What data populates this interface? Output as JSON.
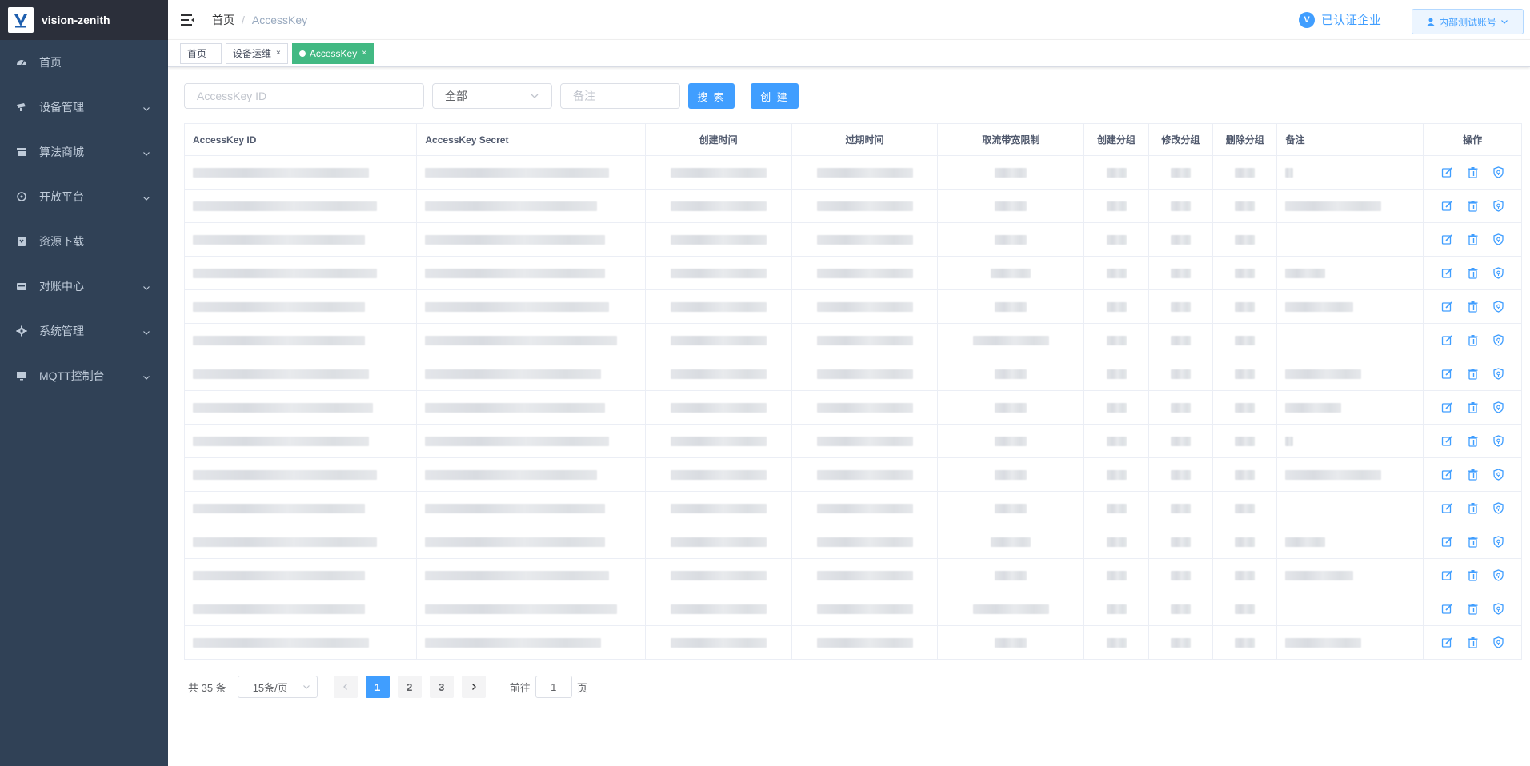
{
  "app": {
    "title": "vision-zenith"
  },
  "sidebar": {
    "items": [
      {
        "label": "首页",
        "icon": "dashboard-icon",
        "has_arrow": false
      },
      {
        "label": "设备管理",
        "icon": "device-icon",
        "has_arrow": true
      },
      {
        "label": "算法商城",
        "icon": "shop-icon",
        "has_arrow": true
      },
      {
        "label": "开放平台",
        "icon": "platform-icon",
        "has_arrow": true
      },
      {
        "label": "资源下载",
        "icon": "download-icon",
        "has_arrow": false
      },
      {
        "label": "对账中心",
        "icon": "billing-icon",
        "has_arrow": true
      },
      {
        "label": "系统管理",
        "icon": "settings-icon",
        "has_arrow": true
      },
      {
        "label": "MQTT控制台",
        "icon": "monitor-icon",
        "has_arrow": true
      }
    ]
  },
  "navbar": {
    "breadcrumb_home": "首页",
    "breadcrumb_sep": "/",
    "breadcrumb_current": "AccessKey",
    "verified_badge": "V",
    "verified_label": "已认证企业",
    "account_label": "内部测试账号"
  },
  "tags": [
    {
      "label": "首页",
      "closable": false,
      "active": false
    },
    {
      "label": "设备运维",
      "closable": true,
      "active": false
    },
    {
      "label": "AccessKey",
      "closable": true,
      "active": true
    }
  ],
  "filters": {
    "id_placeholder": "AccessKey ID",
    "select_value": "全部",
    "remark_placeholder": "备注",
    "search_label": "搜 索",
    "create_label": "创 建"
  },
  "table": {
    "headers": [
      "AccessKey ID",
      "AccessKey Secret",
      "创建时间",
      "过期时间",
      "取流带宽限制",
      "创建分组",
      "修改分组",
      "删除分组",
      "备注",
      "操作"
    ],
    "row_count": 15
  },
  "pagination": {
    "total_label": "共 35 条",
    "page_size_label": "15条/页",
    "pages": [
      "1",
      "2",
      "3"
    ],
    "current_page": "1",
    "goto_prefix": "前往",
    "goto_value": "1",
    "goto_suffix": "页"
  },
  "colors": {
    "sidebar_bg": "#304156",
    "primary": "#409eff",
    "active_tag": "#42b983"
  }
}
